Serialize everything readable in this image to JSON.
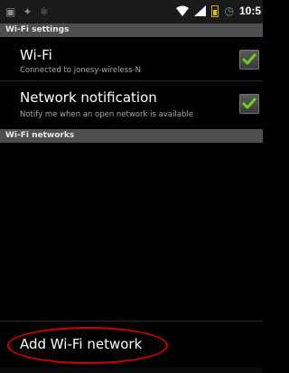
{
  "status_bar": {
    "left_icons": [
      "notification-icon",
      "usb-icon",
      "usb-debug-icon"
    ],
    "time": "10:5",
    "colors": {
      "battery": "#d8c400",
      "signal": "#ffffff"
    }
  },
  "headers": {
    "wifi_settings": "Wi-Fi settings",
    "wifi_networks": "Wi-Fi networks"
  },
  "wifi": {
    "title": "Wi-Fi",
    "subtitle": "Connected to jonesy-wireless-N",
    "checked": true
  },
  "network_notification": {
    "title": "Network notification",
    "subtitle": "Notify me when an open network is available",
    "checked": true
  },
  "add_network": {
    "label": "Add Wi-Fi network",
    "highlight_color": "#d40000"
  },
  "colors": {
    "check": "#6fd21a",
    "header_bg": "#4e4e4e",
    "background": "#000000"
  }
}
